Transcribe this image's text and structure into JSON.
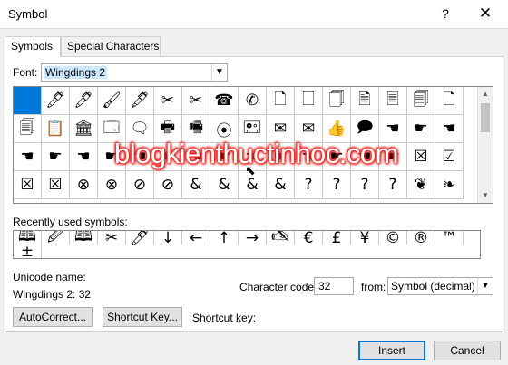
{
  "window": {
    "title": "Symbol",
    "help": "?",
    "close": "✕"
  },
  "tabs": [
    {
      "label": "Symbols",
      "active": true
    },
    {
      "label": "Special Characters",
      "active": false
    }
  ],
  "font": {
    "label": "Font:",
    "value": "Wingdings 2"
  },
  "symbols": [
    " ",
    "🖊",
    "🖊",
    "🖌",
    "🖋",
    "✂",
    "✂",
    "☎",
    "✆",
    "🗋",
    "🗌",
    "🗍",
    "🗎",
    "🗏",
    "🗐",
    "🗋",
    "🗐",
    "📋",
    "🏛",
    "🗔",
    "🗨",
    "🖶",
    "🖷",
    "⦿",
    "🖭",
    "✉",
    "✉",
    "👍",
    "🗩",
    "☚",
    "☛",
    "☚",
    "☚",
    "☛",
    "☚",
    "☛",
    "☚",
    "☛",
    "☚",
    "☛",
    "☚",
    "☛",
    "☚",
    "☛",
    "☚",
    "☛",
    "☒",
    "☑",
    "☒",
    "☒",
    "⊗",
    "⊗",
    "⊘",
    "⊘",
    "&",
    "&",
    "&",
    "&",
    "?",
    "?",
    "?",
    "?",
    "❦",
    "❧"
  ],
  "recent": {
    "label": "Recently used symbols:",
    "symbols": [
      "🕮",
      "🖉",
      "🕮",
      "✂",
      "🖊",
      "↓",
      "←",
      "↑",
      "→",
      "🖎",
      "€",
      "£",
      "¥",
      "©",
      "®",
      "™",
      "±"
    ]
  },
  "watermark": "blogkienthuctinhoc.com",
  "unicode": {
    "label": "Unicode name:",
    "value": "Wingdings 2: 32"
  },
  "char_code": {
    "label": "Character code:",
    "value": "32"
  },
  "from": {
    "label": "from:",
    "value": "Symbol (decimal)"
  },
  "buttons": {
    "autocorrect": "AutoCorrect...",
    "shortcut_key": "Shortcut Key...",
    "insert": "Insert",
    "cancel": "Cancel"
  },
  "shortcut_key_label": "Shortcut key:",
  "colors": {
    "selection": "#0078d7",
    "watermark_glow": "#e8211d"
  }
}
